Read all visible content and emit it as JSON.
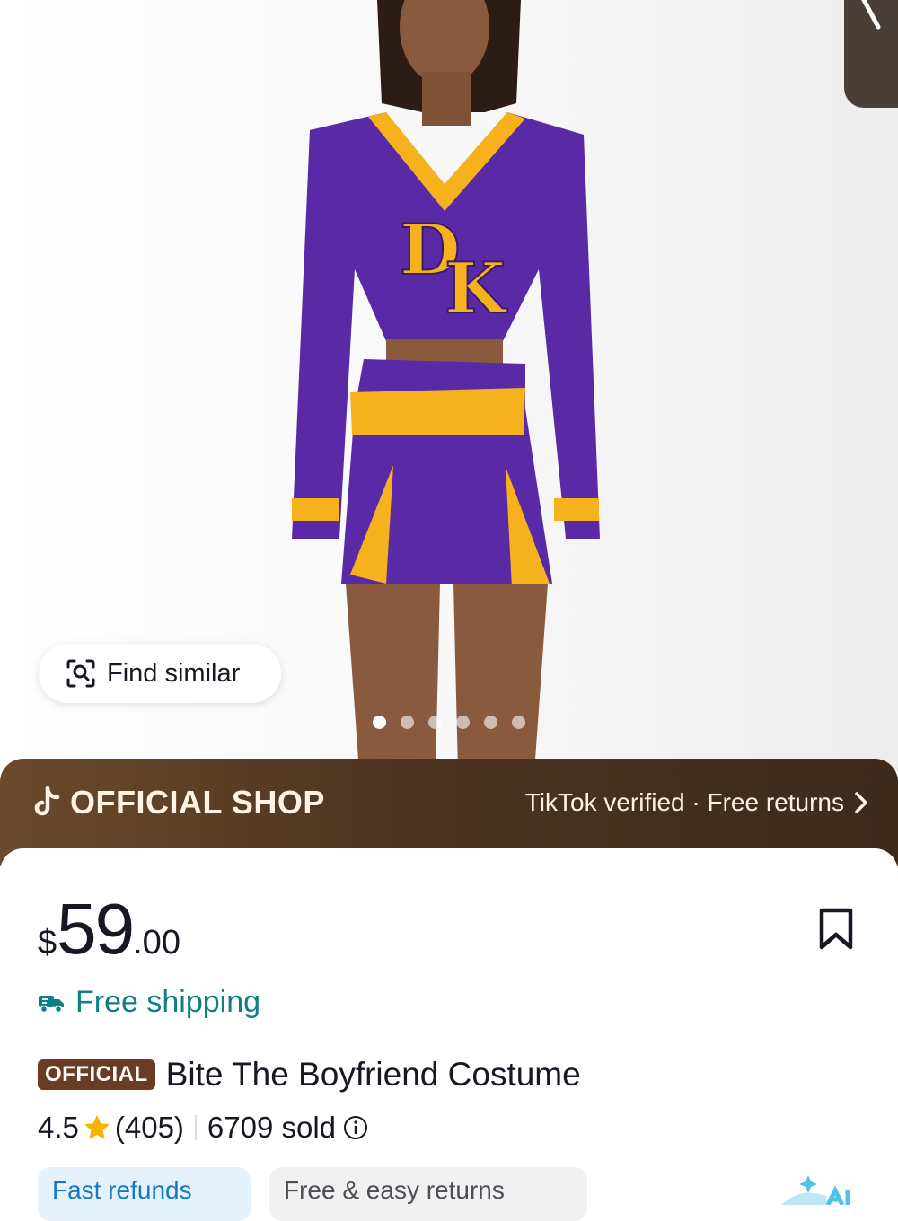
{
  "gallery": {
    "find_similar_label": "Find similar",
    "dots_count": 6,
    "active_index": 0
  },
  "shop_banner": {
    "title": "OFFICIAL SHOP",
    "tagline": "TikTok verified · Free returns"
  },
  "product": {
    "price": {
      "currency": "$",
      "main": "59",
      "decimal": ".00"
    },
    "shipping": "Free shipping",
    "badge": "OFFICIAL",
    "title": "Bite The Boyfriend Costume",
    "rating": "4.5",
    "reviews": "(405)",
    "sold": "6709 sold"
  },
  "chips": {
    "fast_refunds": "Fast refunds",
    "free_returns": "Free & easy returns"
  },
  "colors": {
    "banner_dark": "#4b3421",
    "banner_text": "#fff4e6",
    "shipping_green": "#0f7f83",
    "official_badge": "#6a3b25",
    "star": "#f5b400",
    "chip_blue_text": "#1379c4"
  }
}
